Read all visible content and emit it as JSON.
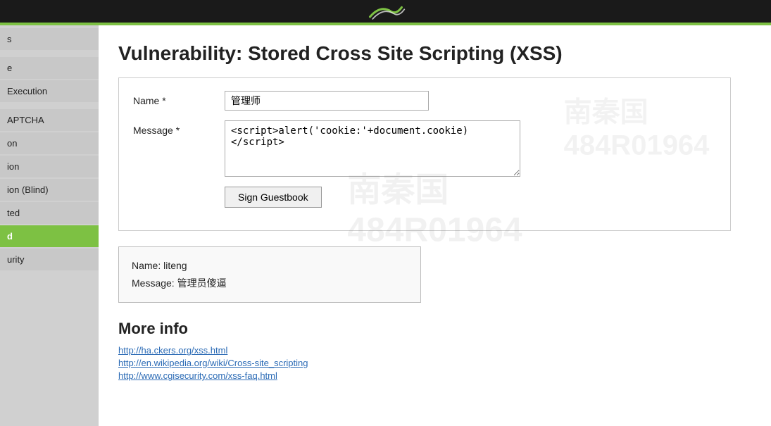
{
  "topbar": {
    "logo_alt": "DVWA Logo"
  },
  "sidebar": {
    "items": [
      {
        "label": "s",
        "active": false,
        "id": "item-s"
      },
      {
        "label": "",
        "active": false,
        "id": "item-blank1"
      },
      {
        "label": "e",
        "active": false,
        "id": "item-e"
      },
      {
        "label": "Execution",
        "active": false,
        "id": "item-execution"
      },
      {
        "label": "",
        "active": false,
        "id": "item-blank2"
      },
      {
        "label": "APTCHA",
        "active": false,
        "id": "item-aptcha"
      },
      {
        "label": "on",
        "active": false,
        "id": "item-on"
      },
      {
        "label": "ion",
        "active": false,
        "id": "item-ion"
      },
      {
        "label": "ion (Blind)",
        "active": false,
        "id": "item-ion-blind"
      },
      {
        "label": "ted",
        "active": false,
        "id": "item-ted"
      },
      {
        "label": "d",
        "active": true,
        "id": "item-d"
      },
      {
        "label": "urity",
        "active": false,
        "id": "item-urity"
      }
    ]
  },
  "main": {
    "title": "Vulnerability: Stored Cross Site Scripting (XSS)",
    "form": {
      "name_label": "Name *",
      "name_value": "管理师",
      "message_label": "Message *",
      "message_value": "<script>alert('cookie:'+document.cookie)</script>",
      "submit_label": "Sign Guestbook"
    },
    "message_card": {
      "name_line": "Name: liteng",
      "message_line": "Message: 管理员傻逼"
    },
    "more_info": {
      "title": "More info",
      "links": [
        {
          "url": "http://ha.ckers.org/xss.html",
          "label": "http://ha.ckers.org/xss.html"
        },
        {
          "url": "http://en.wikipedia.org/wiki/Cross-site_scripting",
          "label": "http://en.wikipedia.org/wiki/Cross-site_scripting"
        },
        {
          "url": "http://www.cgisecurity.com/xss-faq.html",
          "label": "http://www.cgisecurity.com/xss-faq.html"
        }
      ]
    }
  },
  "watermarks": [
    {
      "text": "南秦国\n484R01964",
      "pos": "mid"
    },
    {
      "text": "南秦国\n484R01964",
      "pos": "right"
    }
  ]
}
